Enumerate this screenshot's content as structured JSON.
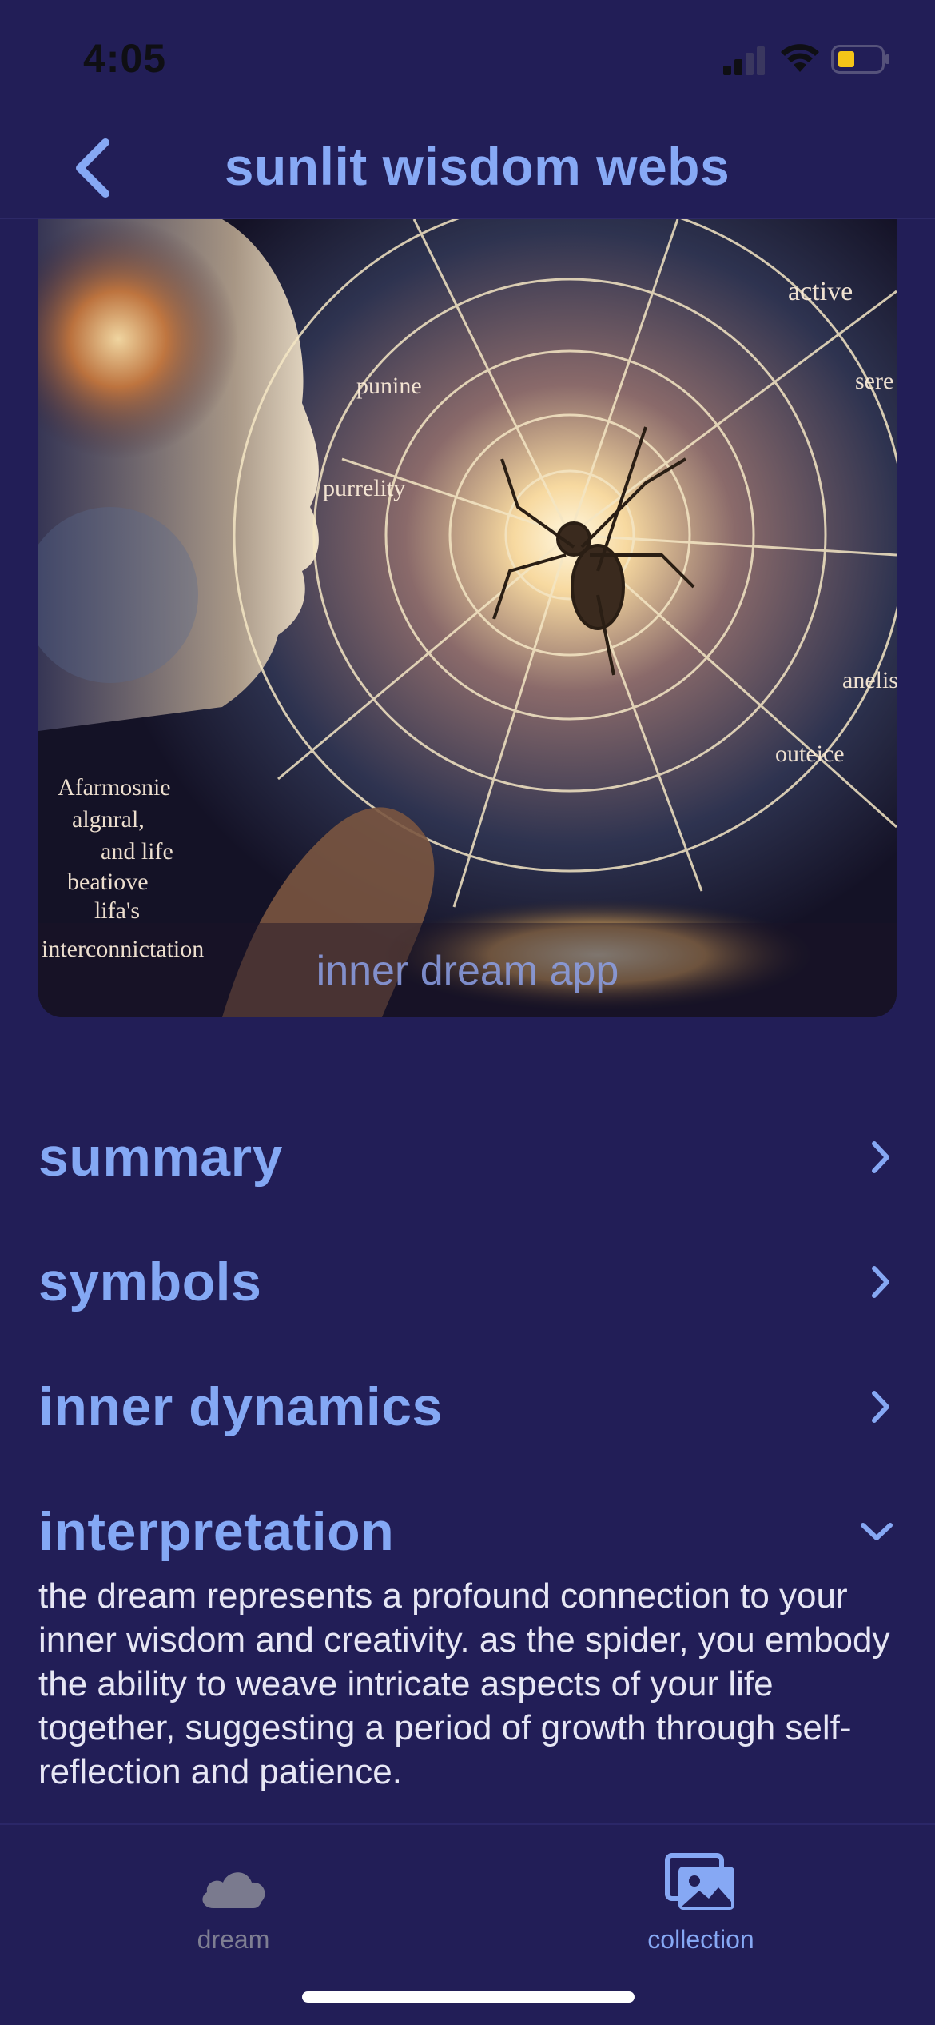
{
  "status_bar": {
    "time": "4:05"
  },
  "header": {
    "title": "sunlit wisdom webs"
  },
  "hero": {
    "caption": "inner dream app",
    "art_words": [
      "active",
      "sere",
      "punine",
      "purrelity",
      "anelis",
      "outeice",
      "Afarmosnie",
      "algnral,",
      "and life",
      "beatiove",
      "lifa's",
      "interconnictation"
    ]
  },
  "sections": [
    {
      "label": "summary",
      "state": "collapsed"
    },
    {
      "label": "symbols",
      "state": "collapsed"
    },
    {
      "label": "inner dynamics",
      "state": "collapsed"
    },
    {
      "label": "interpretation",
      "state": "expanded",
      "body": "the dream represents a profound connection to your inner wisdom and creativity. as the spider, you embody the ability to weave intricate aspects of your life together, suggesting a period of growth through self-reflection and patience."
    }
  ],
  "tabs": [
    {
      "label": "dream",
      "icon": "cloud-icon",
      "active": false
    },
    {
      "label": "collection",
      "icon": "photos-icon",
      "active": true
    }
  ],
  "colors": {
    "background": "#221e57",
    "accent": "#86a8f4",
    "inactive": "#7e7e92",
    "body_text": "#e6e6f4"
  }
}
